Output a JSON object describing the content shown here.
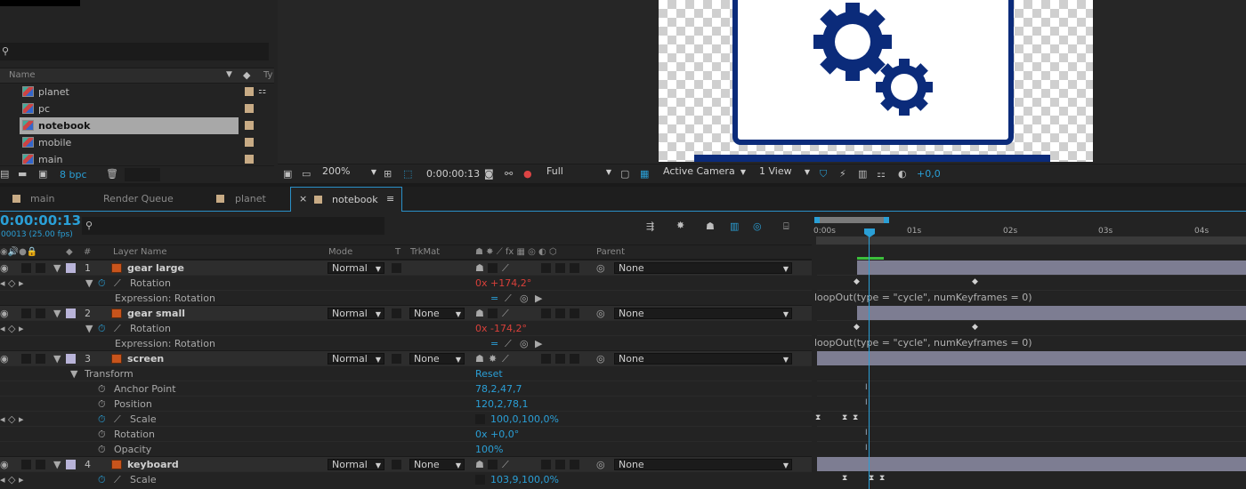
{
  "project": {
    "bit_depth": "8 bpc",
    "columns": {
      "name": "Name",
      "type": "Ty"
    },
    "items": [
      {
        "name": "planet",
        "selected": false
      },
      {
        "name": "pc",
        "selected": false
      },
      {
        "name": "notebook",
        "selected": true
      },
      {
        "name": "mobile",
        "selected": false
      },
      {
        "name": "main",
        "selected": false
      }
    ]
  },
  "viewer": {
    "zoom": "200%",
    "timecode": "0:00:00:13",
    "resolution": "Full",
    "camera": "Active Camera",
    "views": "1 View",
    "exposure": "+0,0"
  },
  "tabs": [
    {
      "label": "main",
      "active": false
    },
    {
      "label": "Render Queue",
      "active": false
    },
    {
      "label": "planet",
      "active": false
    },
    {
      "label": "notebook",
      "active": true
    }
  ],
  "timeline": {
    "timecode": "0:00:00:13",
    "frame_info": "00013 (25.00 fps)",
    "columns": {
      "layer_name": "Layer Name",
      "mode": "Mode",
      "t": "T",
      "trkmat": "TrkMat",
      "parent": "Parent",
      "hash": "#"
    },
    "ruler_labels": [
      "0:00s",
      "01s",
      "02s",
      "03s",
      "04s"
    ],
    "current_time_seconds": 0.52,
    "layers": [
      {
        "num": "1",
        "name": "gear large",
        "mode": "Normal",
        "trkmat": "",
        "parent": "None"
      },
      {
        "num": "2",
        "name": "gear small",
        "mode": "Normal",
        "trkmat": "None",
        "parent": "None"
      },
      {
        "num": "3",
        "name": "screen",
        "mode": "Normal",
        "trkmat": "None",
        "parent": "None"
      },
      {
        "num": "4",
        "name": "keyboard",
        "mode": "Normal",
        "trkmat": "None",
        "parent": "None"
      }
    ],
    "props": {
      "rotation1": {
        "label": "Rotation",
        "value": "0x +174,2°"
      },
      "expr1": {
        "label": "Expression: Rotation",
        "code": "loopOut(type = \"cycle\", numKeyframes = 0)"
      },
      "rotation2": {
        "label": "Rotation",
        "value": "0x -174,2°"
      },
      "expr2": {
        "label": "Expression: Rotation",
        "code": "loopOut(type = \"cycle\", numKeyframes = 0)"
      },
      "transform": {
        "label": "Transform",
        "reset": "Reset"
      },
      "anchor": {
        "label": "Anchor Point",
        "value": "78,2,47,7"
      },
      "position": {
        "label": "Position",
        "value": "120,2,78,1"
      },
      "scale3": {
        "label": "Scale",
        "value": "100,0,100,0%"
      },
      "rotation3": {
        "label": "Rotation",
        "value": "0x +0,0°"
      },
      "opacity": {
        "label": "Opacity",
        "value": "100%"
      },
      "scale4": {
        "label": "Scale",
        "value": "103,9,100,0%"
      }
    }
  }
}
